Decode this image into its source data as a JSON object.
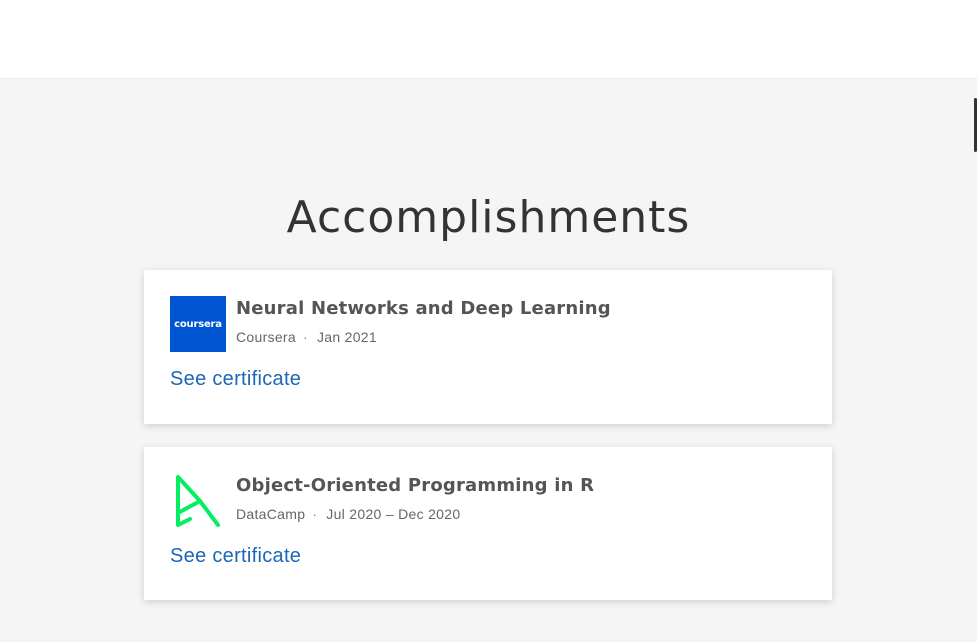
{
  "section": {
    "title": "Accomplishments"
  },
  "accomplishments": [
    {
      "title": "Neural Networks and Deep Learning",
      "issuer": "Coursera",
      "separator": "·",
      "date": "Jan 2021",
      "link_label": "See certificate",
      "logo_icon": "coursera-logo",
      "logo_text": "coursera",
      "logo_color": "#0056d2"
    },
    {
      "title": "Object-Oriented Programming in R",
      "issuer": "DataCamp",
      "separator": "·",
      "date": "Jul 2020 – Dec 2020",
      "link_label": "See certificate",
      "logo_icon": "datacamp-logo",
      "logo_color": "#03ef62"
    }
  ],
  "colors": {
    "link": "#1a66b8",
    "background": "#f5f5f5",
    "card": "#ffffff"
  }
}
